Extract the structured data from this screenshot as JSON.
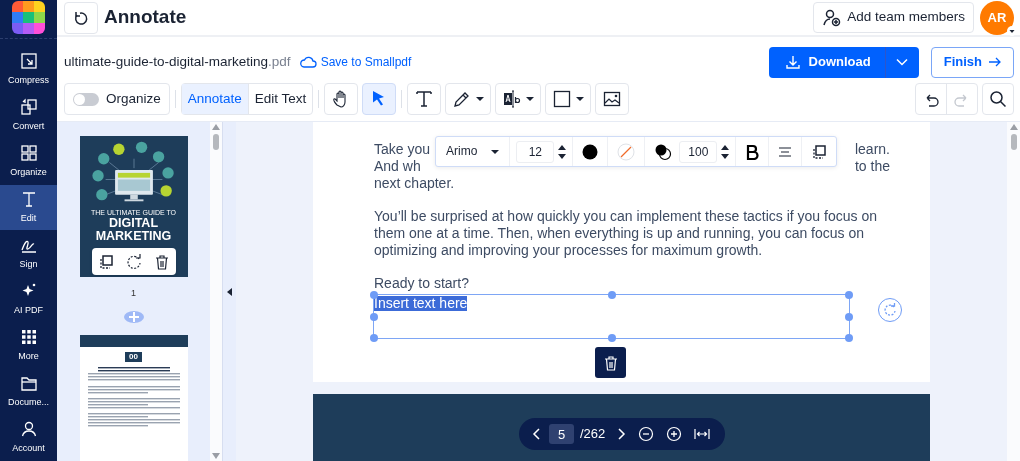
{
  "sidebar": {
    "items": [
      {
        "kind": "compress",
        "label": "Compress",
        "selected": false
      },
      {
        "kind": "convert",
        "label": "Convert",
        "selected": false
      },
      {
        "kind": "organize",
        "label": "Organize",
        "selected": false
      },
      {
        "kind": "edit",
        "label": "Edit",
        "selected": true
      },
      {
        "kind": "sign",
        "label": "Sign",
        "selected": false
      },
      {
        "kind": "ai",
        "label": "AI PDF",
        "selected": false
      },
      {
        "kind": "more",
        "label": "More",
        "selected": false
      },
      {
        "kind": "documents",
        "label": "Docume...",
        "selected": false
      },
      {
        "kind": "account",
        "label": "Account",
        "selected": false
      }
    ]
  },
  "header": {
    "title": "Annotate",
    "add_team": "Add team members",
    "avatar": "AR"
  },
  "file": {
    "name": "ultimate-guide-to-digital-marketing",
    "extension": ".pdf",
    "save_link": "Save to Smallpdf"
  },
  "actions": {
    "download": "Download",
    "finish": "Finish"
  },
  "toolbar": {
    "organize": {
      "label": "Organize",
      "on": false
    },
    "modes": [
      {
        "label": "Annotate",
        "selected": true
      },
      {
        "label": "Edit Text",
        "selected": false
      }
    ],
    "tools": [
      {
        "kind": "hand",
        "selected": false
      },
      {
        "kind": "pointer",
        "selected": true
      },
      {
        "kind": "text",
        "selected": false
      },
      {
        "kind": "pen",
        "selected": false
      },
      {
        "kind": "textstyle",
        "selected": false
      },
      {
        "kind": "shape",
        "selected": false
      },
      {
        "kind": "image",
        "selected": false
      }
    ]
  },
  "history": {
    "undo_disabled": false,
    "redo_disabled": true
  },
  "thumbnails": [
    {
      "kind": "cover",
      "number": "1",
      "subtitle": "THE ULTIMATE GUIDE TO",
      "title_lines": [
        "DIGITAL",
        "MARKETING"
      ]
    },
    {
      "kind": "chapter",
      "chapter_number": "00"
    }
  ],
  "document": {
    "partial_lines": [
      [
        "Take you",
        "learn."
      ],
      [
        "And wh",
        "to the"
      ],
      [
        "next chapter."
      ]
    ],
    "paragraphs": [
      "You’ll be surprised at how quickly you can implement these tactics if you focus on them one at a time. Then, when everything is up and running, you can focus on optimizing and improving your processes for maximum growth.",
      "Ready to start?"
    ],
    "textbox": {
      "text": "Insert text here",
      "selected": true
    }
  },
  "format_bar": {
    "font": "Arimo",
    "size": "12",
    "opacity": "100"
  },
  "pager": {
    "page": "5",
    "total": "/262"
  }
}
